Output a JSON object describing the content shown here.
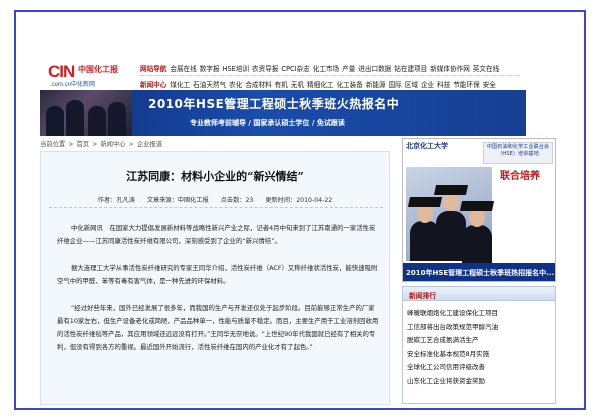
{
  "logo": {
    "mark": "CIN",
    "cn": "中国化工报",
    "domain": ".com.cn中化新网"
  },
  "nav": {
    "primary_label": "网站导航",
    "primary": [
      "会展在线",
      "数字报",
      "HSE培训",
      "农资导报",
      "CPCI杂志",
      "化工市场",
      "产量",
      "进出口数据",
      "钻在建项目",
      "新媒体协作网",
      "英文在线"
    ],
    "secondary_label": "新闻中心",
    "secondary": [
      "煤化工",
      "石油天然气",
      "农化",
      "合成材料",
      "有机",
      "无机",
      "精细化工",
      "化工装备",
      "新能源",
      "国际",
      "区域",
      "企业",
      "科技",
      "节能环保",
      "安全"
    ]
  },
  "banner": {
    "title": "2010年HSE管理工程硕士秋季班火热报名中",
    "subtitle": "专业教师考前辅导 / 国家承认硕士学位 / 免试跟读"
  },
  "breadcrumb": [
    "当前位置",
    ">",
    "首页",
    ">",
    "新闻中心",
    ">",
    "企业报道"
  ],
  "article": {
    "title": "江苏同康：材料小企业的“新兴情结”",
    "author_label": "作者：孔凡涛",
    "source_label": "文章来源：中国化工报",
    "hits_label": "点击数：23",
    "updated_label": "更新时间：2010-04-22",
    "paragraphs": [
      "中化新网讯　在国家大力提倡发展新材料等战略性新兴产业之际，记者4月中旬来到了江苏南通的一家活性炭纤维企业——江苏同康活性炭纤维有限公司，深刻感受到了企业的“新兴情结”。",
      "据大连理工大学从事活性炭纤维研究的专家王同华介绍，活性炭纤维（ACF）又称纤维状活性炭，能快速吸附空气中的甲醛、苯等有毒有害气体，是一种先进的环保材料。",
      "“经过好些年来，国外已经发展了很多年，而我国的生产与开发还仅处于起步阶段。目前能够正常生产的厂家最有10家左右，但生产设备老化或简陋，产品品种单一，性能与质量不稳定。而且，主要生产用于工业溶剂回收用的活性炭纤维毡等产品，其应用领域还远远没有打开。”王同华无奈地说。“上世纪90年代我国就已经有了相关的专利，但没有得到各方的重视。最近国外开始流行，活性炭纤维在国内的产业化才有了起色。”"
    ]
  },
  "ad": {
    "school": "北京化工大学",
    "tag": "中国石油和化学工业联合会（HSE）培训基地",
    "joint": "联合培养",
    "strip": "2010年HSE管理工程硕士秋季班热招报名中..."
  },
  "rank": {
    "title": "新闻排行",
    "items": [
      "峰暖联烟炮化工建设保化工项目",
      "工信部将出台政策规范甲醇汽油",
      "脱碳工艺合成氨满活生产",
      "安全标准化基本规范8月实施",
      "全球化工公司信用评级改善",
      "山东化工企业将获资金奖励"
    ]
  }
}
